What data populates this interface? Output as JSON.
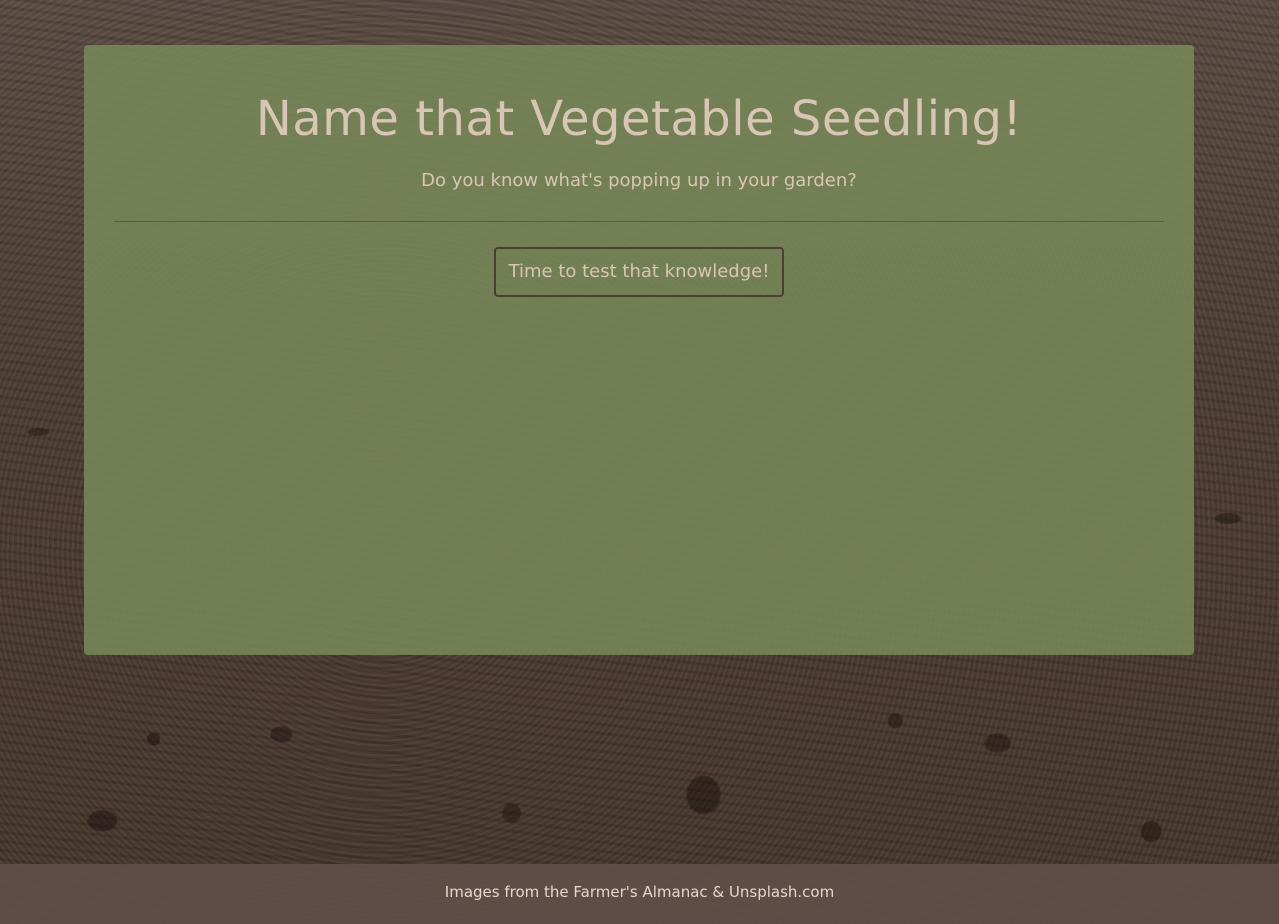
{
  "card": {
    "title": "Name that Vegetable Seedling!",
    "subtitle": "Do you know what's popping up in your garden?",
    "start_button_label": "Time to test that knowledge!"
  },
  "footer": {
    "credits": "Images from the Farmer's Almanac & Unsplash.com"
  },
  "colors": {
    "card_background": "#788858",
    "text": "#d8c6b4",
    "button_border": "#4a3f33",
    "footer_background": "#64504b",
    "soil_background": "#4a3a31"
  }
}
